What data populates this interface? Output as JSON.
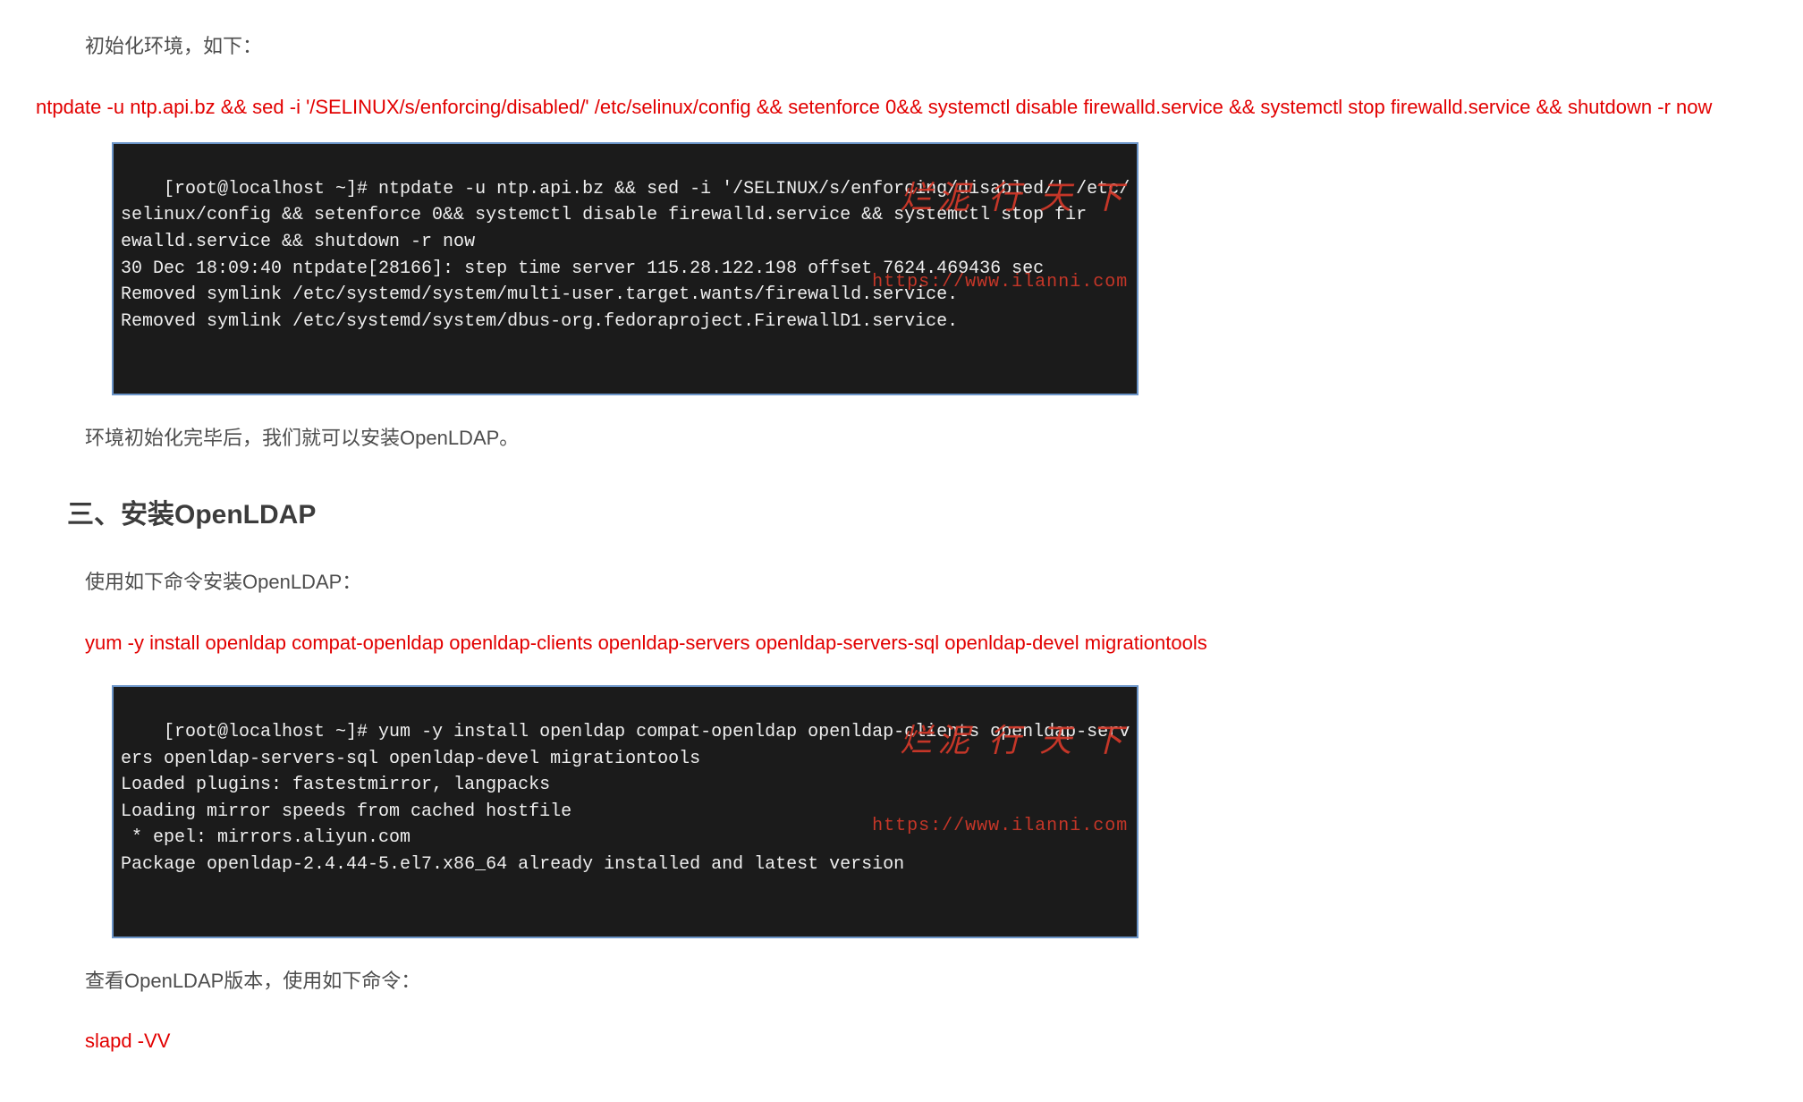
{
  "p1": "初始化环境，如下：",
  "cmd1": "ntpdate -u ntp.api.bz && sed -i '/SELINUX/s/enforcing/disabled/' /etc/selinux/config && setenforce 0&& systemctl disable firewalld.service && systemctl stop firewalld.service && shutdown -r now",
  "term1": "[root@localhost ~]# ntpdate -u ntp.api.bz && sed -i '/SELINUX/s/enforcing/disabled/' /etc/\nselinux/config && setenforce 0&& systemctl disable firewalld.service && systemctl stop fir\newalld.service && shutdown -r now\n30 Dec 18:09:40 ntpdate[28166]: step time server 115.28.122.198 offset 7624.469436 sec\nRemoved symlink /etc/systemd/system/multi-user.target.wants/firewalld.service.\nRemoved symlink /etc/systemd/system/dbus-org.fedoraproject.FirewallD1.service.",
  "p2": "环境初始化完毕后，我们就可以安装OpenLDAP。",
  "h2": "三、安装OpenLDAP",
  "p3": "使用如下命令安装OpenLDAP：",
  "cmd2": "yum -y install openldap compat-openldap openldap-clients openldap-servers openldap-servers-sql openldap-devel migrationtools",
  "term2": "[root@localhost ~]# yum -y install openldap compat-openldap openldap-clients openldap-serv\ners openldap-servers-sql openldap-devel migrationtools\nLoaded plugins: fastestmirror, langpacks\nLoading mirror speeds from cached hostfile\n * epel: mirrors.aliyun.com\nPackage openldap-2.4.44-5.el7.x86_64 already installed and latest version",
  "p4": "查看OpenLDAP版本，使用如下命令：",
  "cmd3": "slapd -VV",
  "watermark_main": "烂泥 行 天 下",
  "watermark_sub": "https://www.ilanni.com"
}
